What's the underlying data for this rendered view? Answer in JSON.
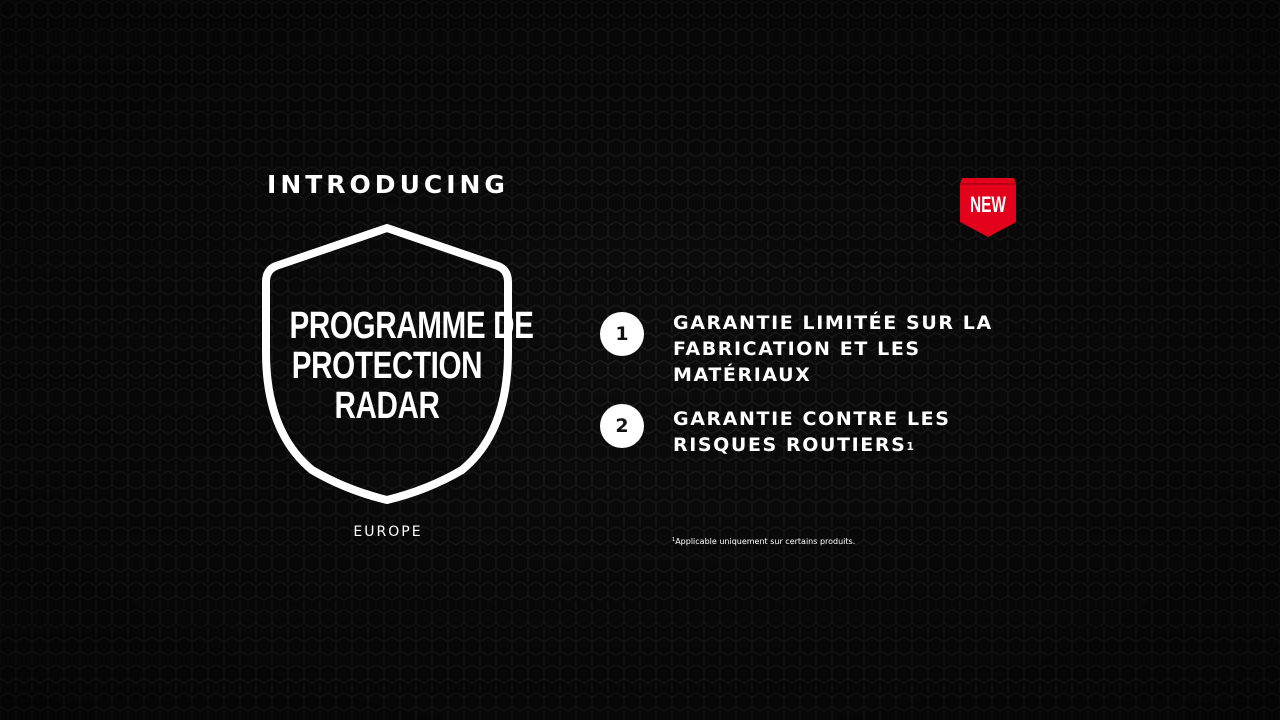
{
  "colors": {
    "background": "#0b0b0b",
    "pattern": "#1e1e1e",
    "accent_red": "#e3001b",
    "text": "#ffffff"
  },
  "intro": "INTRODUCING",
  "shield": {
    "line1": "PROGRAMME DE",
    "line2": "PROTECTION",
    "line3": "RADAR",
    "region": "EUROPE"
  },
  "badge": {
    "label": "NEW"
  },
  "features": [
    {
      "number": "1",
      "lines": [
        "GARANTIE LIMITÉE SUR LA",
        "FABRICATION ET LES",
        "MATÉRIAUX"
      ]
    },
    {
      "number": "2",
      "lines": [
        "GARANTIE CONTRE LES",
        "RISQUES ROUTIERS"
      ],
      "superscript": "1"
    }
  ],
  "footnote": {
    "marker": "1",
    "text": "Applicable uniquement sur certains produits."
  }
}
